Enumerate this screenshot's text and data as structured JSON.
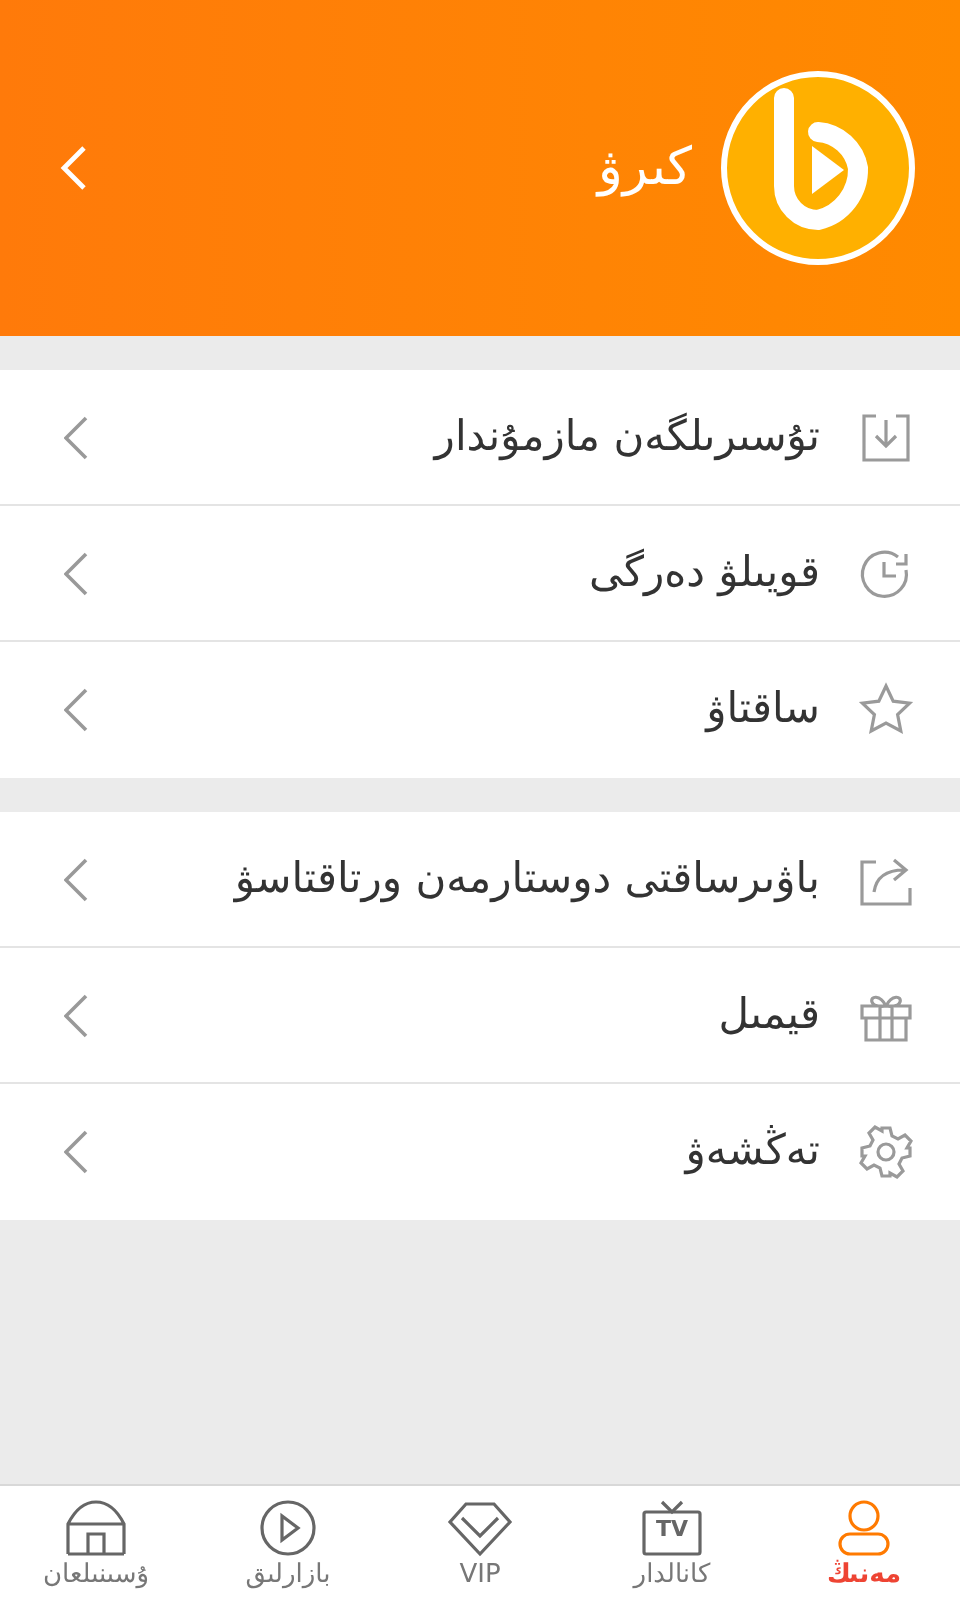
{
  "header": {
    "title": "كىرۋ"
  },
  "groups": [
    {
      "items": [
        {
          "label": "تۇسىرىلگەن مازمۇندار",
          "kind": "download"
        },
        {
          "label": "قويىلۋ دەرگى",
          "kind": "history"
        },
        {
          "label": "ساقتاۋ",
          "kind": "star"
        }
      ]
    },
    {
      "items": [
        {
          "label": "باۋىرساقتى دوستارمەن ورتاقتاسۋ",
          "kind": "share"
        },
        {
          "label": "قيمىل",
          "kind": "gift"
        },
        {
          "label": "تەڭشەۋ",
          "kind": "settings"
        }
      ]
    }
  ],
  "tabs": [
    {
      "label": "مەنىڭ",
      "kind": "user",
      "selected": true
    },
    {
      "label": "كانالدار",
      "kind": "tv",
      "icon_text": "TV",
      "selected": false
    },
    {
      "label": "VIP",
      "kind": "vip",
      "selected": false
    },
    {
      "label": "بازارلىق",
      "kind": "play",
      "selected": false
    },
    {
      "label": "ۇسىنىلعان",
      "kind": "home",
      "selected": false
    }
  ]
}
